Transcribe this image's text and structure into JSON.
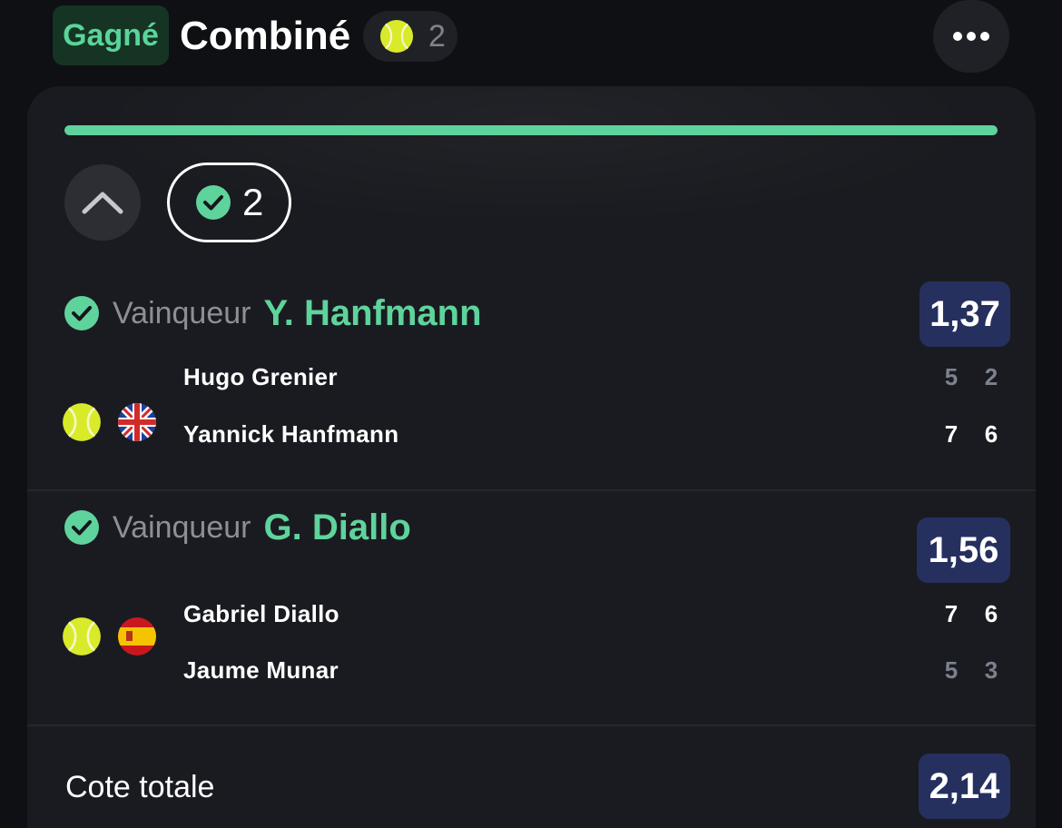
{
  "header": {
    "status": "Gagné",
    "title": "Combiné",
    "selection_count": "2"
  },
  "card": {
    "progress": 1.0,
    "won_count": "2",
    "selections": [
      {
        "market": "Vainqueur",
        "pick": "Y. Hanfmann",
        "odds": "1,37",
        "flag": "gb",
        "players": [
          {
            "name": "Hugo Grenier",
            "sets": [
              "5",
              "2"
            ]
          },
          {
            "name": "Yannick Hanfmann",
            "sets": [
              "7",
              "6"
            ]
          }
        ]
      },
      {
        "market": "Vainqueur",
        "pick": "G. Diallo",
        "odds": "1,56",
        "flag": "es",
        "players": [
          {
            "name": "Gabriel Diallo",
            "sets": [
              "7",
              "6"
            ]
          },
          {
            "name": "Jaume Munar",
            "sets": [
              "5",
              "3"
            ]
          }
        ]
      }
    ],
    "total_label": "Cote totale",
    "total_odds": "2,14"
  },
  "colors": {
    "accent_green": "#5fd39c",
    "odds_badge": "#26305f",
    "background": "#0e1014",
    "card": "#1a1b20"
  },
  "icons": [
    "tennis-ball-icon",
    "more-icon",
    "chevron-up-icon",
    "check-circle-icon",
    "uk-flag-icon",
    "spain-flag-icon"
  ]
}
